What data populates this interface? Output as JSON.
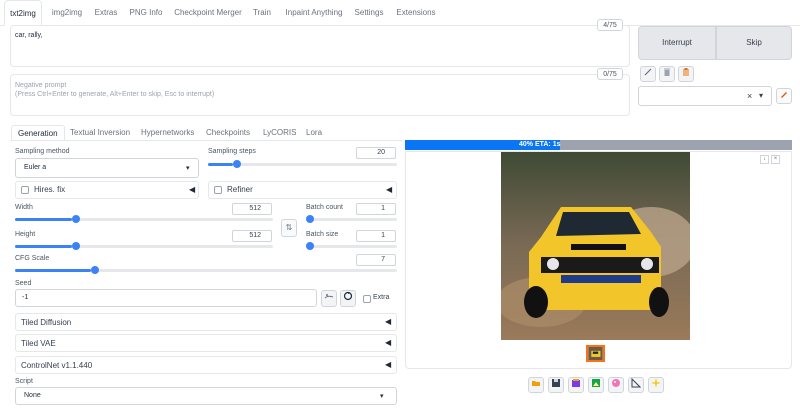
{
  "tabs": [
    "txt2img",
    "img2img",
    "Extras",
    "PNG Info",
    "Checkpoint Merger",
    "Train",
    "Inpaint Anything",
    "Settings",
    "Extensions"
  ],
  "prompt": {
    "value": "car, rally,",
    "counter": "4/75"
  },
  "negative_prompt": {
    "placeholder_line1": "Negative prompt",
    "placeholder_line2": "(Press Ctrl+Enter to generate, Alt+Enter to skip, Esc to interrupt)",
    "counter": "0/75"
  },
  "buttons": {
    "interrupt": "Interrupt",
    "skip": "Skip"
  },
  "style_select": {
    "clear": "×",
    "arrow": "▾"
  },
  "subtabs": [
    "Generation",
    "Textual Inversion",
    "Hypernetworks",
    "Checkpoints",
    "LyCORIS",
    "Lora"
  ],
  "sampling": {
    "method_label": "Sampling method",
    "method_value": "Euler a",
    "steps_label": "Sampling steps",
    "steps_value": "20",
    "steps_fraction": 0.133
  },
  "hires": {
    "label": "Hires. fix"
  },
  "refiner": {
    "label": "Refiner"
  },
  "width": {
    "label": "Width",
    "value": "512",
    "fraction": 0.222
  },
  "height": {
    "label": "Height",
    "value": "512",
    "fraction": 0.222
  },
  "swap_icon": "⇅",
  "batch_count": {
    "label": "Batch count",
    "value": "1",
    "fraction": 0.0
  },
  "batch_size": {
    "label": "Batch size",
    "value": "1",
    "fraction": 0.0
  },
  "cfg": {
    "label": "CFG Scale",
    "value": "7",
    "fraction": 0.2
  },
  "seed": {
    "label": "Seed",
    "value": "-1",
    "extra_label": "Extra"
  },
  "accordions": [
    "Tiled Diffusion",
    "Tiled VAE",
    "ControlNet v1.1.440"
  ],
  "script": {
    "label": "Script",
    "value": "None"
  },
  "progress": {
    "text": "40% ETA: 1s",
    "fraction": 0.4
  },
  "colors": {
    "accent": "#3b82f6",
    "progress": "#0b76f5",
    "car_yellow": "#f2c62a"
  }
}
